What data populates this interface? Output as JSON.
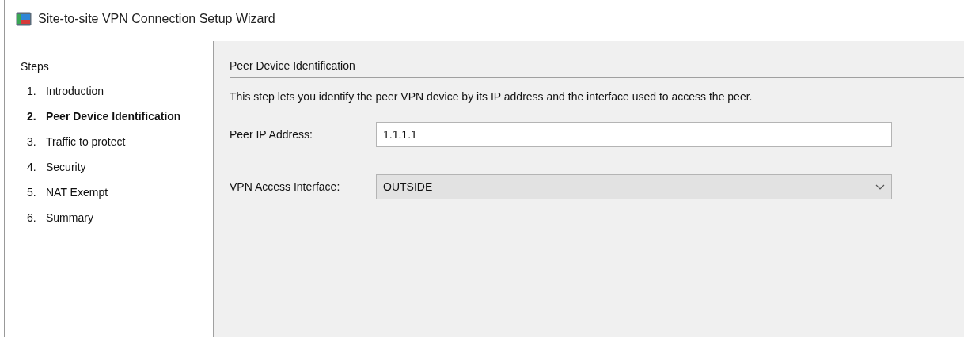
{
  "window": {
    "title": "Site-to-site VPN Connection Setup Wizard"
  },
  "steps": {
    "heading": "Steps",
    "items": [
      {
        "number": "1.",
        "label": "Introduction",
        "selected": false
      },
      {
        "number": "2.",
        "label": "Peer Device Identification",
        "selected": true
      },
      {
        "number": "3.",
        "label": "Traffic to protect",
        "selected": false
      },
      {
        "number": "4.",
        "label": "Security",
        "selected": false
      },
      {
        "number": "5.",
        "label": "NAT Exempt",
        "selected": false
      },
      {
        "number": "6.",
        "label": "Summary",
        "selected": false
      }
    ]
  },
  "panel": {
    "heading": "Peer Device Identification",
    "description": "This step lets you identify the peer VPN device by its IP address and the interface used to access the peer.",
    "fields": [
      {
        "kind": "text",
        "label": "Peer IP Address:",
        "value": "1.1.1.1"
      },
      {
        "kind": "dropdown",
        "label": "VPN Access Interface:",
        "value": "OUTSIDE"
      }
    ]
  }
}
